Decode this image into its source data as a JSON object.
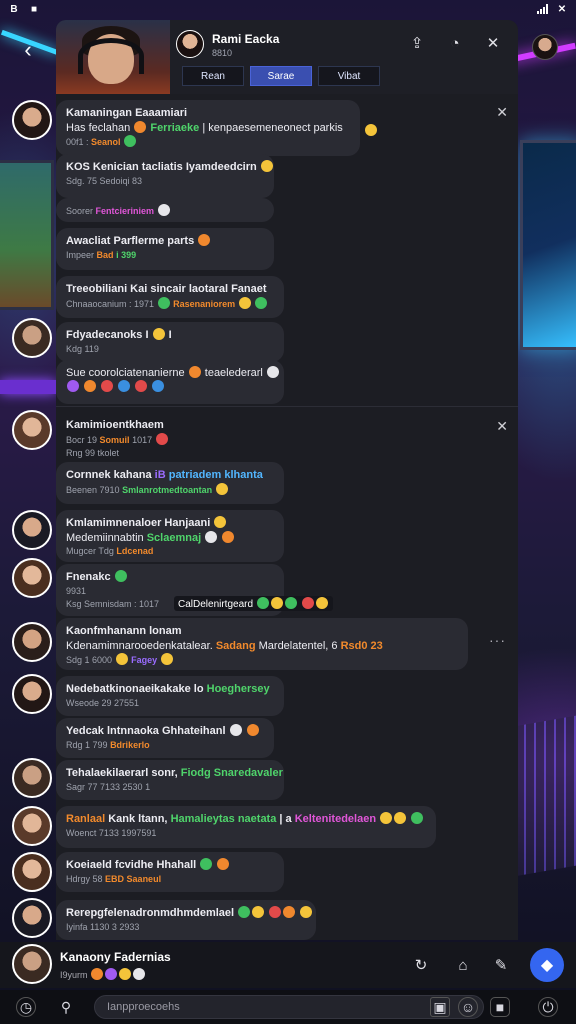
{
  "status": {
    "left_icons": [
      "app-icon-b",
      "app-icon-square"
    ],
    "right_icons": [
      "signal-icon",
      "close-icon"
    ]
  },
  "header": {
    "title": "Rami Eacka",
    "subtitle": "8810",
    "tabs": [
      {
        "label": "Rean",
        "active": false
      },
      {
        "label": "Sarae",
        "active": true
      },
      {
        "label": "Vibat",
        "active": false
      }
    ],
    "actions": [
      "share-icon",
      "chat-bubble-icon",
      "close-icon"
    ]
  },
  "messages": [
    {
      "l1": "Kamaningan Eaaamiari",
      "l2a": "Has feclahan",
      "l2b": "Ferriaeke",
      "l2c": "| kenpaesemeneonect parkis",
      "l3a": "00f1 :",
      "l3b": "Seanol"
    },
    {
      "l1": "KOS Kenician tacliatis Iyamdeedcirn",
      "l3a": "Sdg. 75 Sedoiqi 83"
    },
    {
      "l3a": "Soorer",
      "l3b": "Fentcieriniem"
    },
    {
      "l1": "Awacliat Parflerme parts",
      "l3a": "Impeer",
      "l3b": "Bad",
      "l3c": "i 399"
    },
    {
      "l1": "Treeobiliani Kai sincair laotaral Fanaet",
      "l3a": "Chnaaocanium : 1971",
      "l3b": "Rasenaniorem"
    },
    {
      "l1": "Fdyadecanoks I",
      "l1b": "I",
      "l3a": "Kdg 119"
    },
    {
      "l2a": "Sue coorolciatenanierne",
      "l2b": "teaelederarl"
    },
    {
      "l1": "Kamimioentkhaem",
      "l3a": "Bocr 19",
      "l3b": "Somuil",
      "l3c": "1017",
      "l3d": "Rng 99 tkolet"
    },
    {
      "l1": "Cornnek kahana",
      "l1b": "iB",
      "l1c": "patriadem klhanta",
      "l3a": "Beenen 7910",
      "l3b": "Smlanrotmedtoantan"
    },
    {
      "l1": "Kmlamimnenaloer Hanjaani",
      "l2a": "Medemiinnabtin",
      "l2b": "Sclaemnaj",
      "l3a": "Mugcer Tdg",
      "l3b": "Ldcenad"
    },
    {
      "l1": "Fnenakc",
      "l2a": "9931",
      "l3a": "Ksg Semnisdam : 1017",
      "l3b": "CalDelenirtgeard"
    },
    {
      "l1": "Kaonfmhanann lonam",
      "l2a": "Kdenamimnarooedenkatalear.",
      "l2b": "Sadang",
      "l2c": "Mardelatentel, 6",
      "l2d": "Rsd0 23",
      "l3a": "Sdg 1 6000",
      "l3b": "Fagey"
    },
    {
      "l1": "Nedebatkinonaeikakake lo",
      "l1b": "Hoeghersey",
      "l3a": "Wseode 29 27551"
    },
    {
      "l1": "Yedcak lntnnaoka Ghhateihanl",
      "l3a": "Rdg 1 799",
      "l3b": "Bdrikerlo"
    },
    {
      "l1": "Tehalaekilaerarl sonr,",
      "l1b": "Fiodg Snaredavaler",
      "l3a": "Sagr 77 7133 2530 1"
    },
    {
      "l1a": "Ranlaal",
      "l1": "Kank ltann,",
      "l1b": "Hamalieytas naetata",
      "l1c": "| a",
      "l1d": "Keltenitedelaen",
      "l3a": "Woenct 7133 1997591"
    },
    {
      "l1": "Koeiaeld fcvidhe Hhahall",
      "l3a": "Hdrgy 58",
      "l3b": "EBD Saaneul"
    },
    {
      "l1": "Rerepgfelenadronmdhmdemlael",
      "l3a": "Iyinfa 1130 3 2933"
    }
  ],
  "userbar": {
    "name": "Kanaony Fadernias",
    "sub": "I9yurm",
    "icons": [
      "refresh-icon",
      "home-icon",
      "edit-icon"
    ],
    "fab_icon": "diamond-icon"
  },
  "inputbar": {
    "placeholder": "Ianpproecoehs",
    "icons_left": [
      "clock-icon",
      "attach-icon"
    ],
    "icons_right": [
      "image-icon",
      "emoji-icon",
      "stop-icon",
      "power-icon"
    ]
  },
  "colors": {
    "accent": "#3466f0",
    "panel": "#1c1d23",
    "bubble": "#2a2b33",
    "green": "#4fd46b",
    "pink": "#e056d8",
    "orange": "#f28a2c"
  }
}
